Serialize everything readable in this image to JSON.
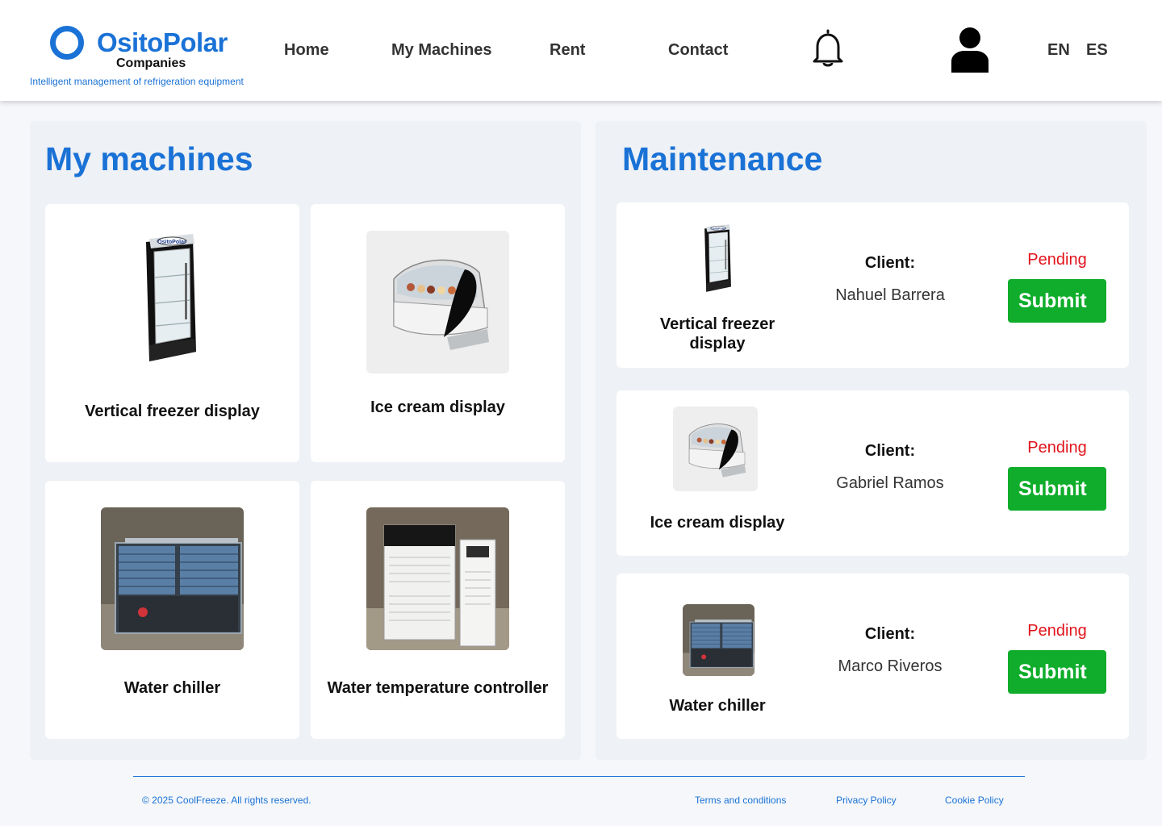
{
  "brand": {
    "name": "OsitoPolar",
    "sub": "Companies",
    "tagline": "Intelligent management of refrigeration equipment",
    "color": "#1a72d6"
  },
  "nav": {
    "items": [
      "Home",
      "My Machines",
      "Rent",
      "Contact"
    ],
    "icons": [
      "bell-icon",
      "user-icon"
    ],
    "languages": [
      "EN",
      "ES"
    ]
  },
  "my_machines": {
    "title": "My machines",
    "items": [
      {
        "name": "Vertical freezer display",
        "image": "vertical-freezer-image"
      },
      {
        "name": "Ice cream display",
        "image": "ice-cream-display-image"
      },
      {
        "name": "Water chiller",
        "image": "water-chiller-image"
      },
      {
        "name": "Water temperature controller",
        "image": "water-temperature-controller-image"
      }
    ]
  },
  "maintenance": {
    "title": "Maintenance",
    "client_label": "Client:",
    "items": [
      {
        "machine": "Vertical freezer display",
        "client": "Nahuel Barrera",
        "status": "Pending",
        "action": "Submit"
      },
      {
        "machine": "Ice cream display",
        "client": "Gabriel Ramos",
        "status": "Pending",
        "action": "Submit"
      },
      {
        "machine": "Water chiller",
        "client": "Marco Riveros",
        "status": "Pending",
        "action": "Submit"
      }
    ],
    "status_color": "#e0141b",
    "submit_color": "#0fad2b"
  },
  "footer": {
    "copyright": "© 2025 CoolFreeze. All rights reserved.",
    "links": [
      "Terms and conditions",
      "Privacy Policy",
      "Cookie Policy"
    ]
  }
}
